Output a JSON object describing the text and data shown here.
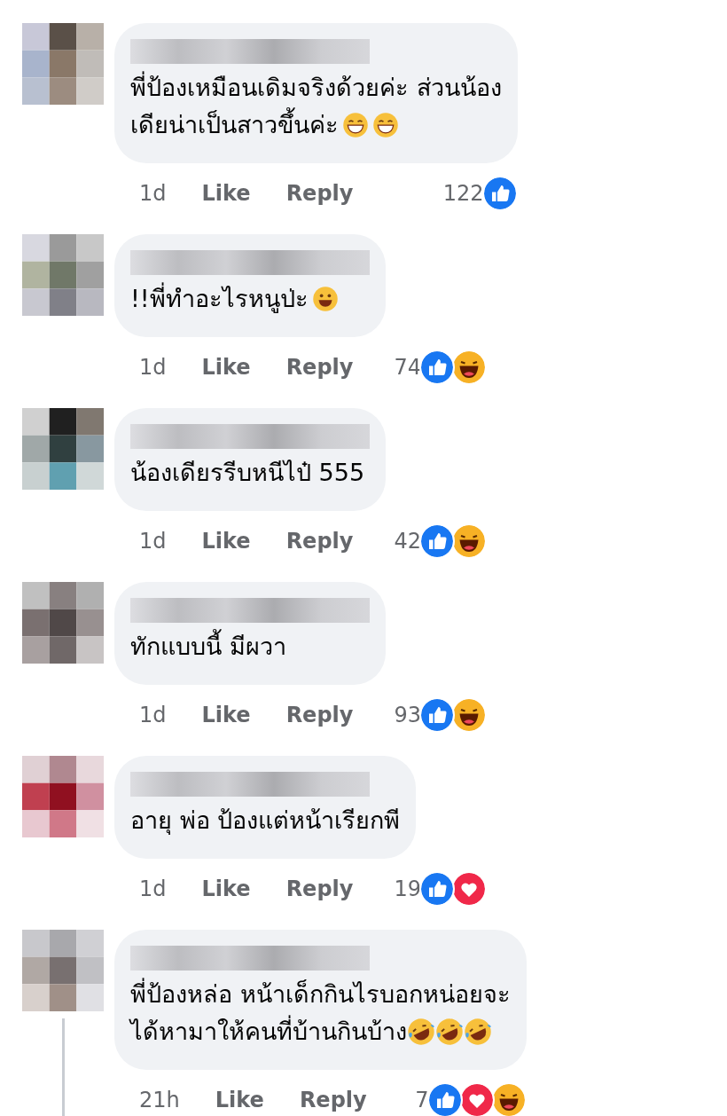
{
  "comments": [
    {
      "text_lines": [
        "พี่ป้องเหมือนเดิมจริงด้วยค่ะ ส่วนน้อง",
        "เดียน่าเป็นสาวขึ้นค่ะ"
      ],
      "emoji": [
        {
          "kind": "grin"
        },
        {
          "kind": "grin"
        }
      ],
      "time": "1d",
      "like": "Like",
      "reply": "Reply",
      "count": "122",
      "reactions": [
        {
          "kind": "like"
        }
      ],
      "thread": false
    },
    {
      "text_lines": [
        "!!พี่ทำอะไรหนูป่ะ"
      ],
      "emoji": [
        {
          "kind": "smile"
        }
      ],
      "time": "1d",
      "like": "Like",
      "reply": "Reply",
      "count": "74",
      "reactions": [
        {
          "kind": "like"
        },
        {
          "kind": "haha"
        }
      ],
      "thread": false
    },
    {
      "text_lines": [
        "น้องเดียรรีบหนีไป๋ 555"
      ],
      "time": "1d",
      "like": "Like",
      "reply": "Reply",
      "count": "42",
      "reactions": [
        {
          "kind": "like"
        },
        {
          "kind": "haha"
        }
      ],
      "thread": false
    },
    {
      "text_lines": [
        "ทักแบบนี้ มีผวา"
      ],
      "time": "1d",
      "like": "Like",
      "reply": "Reply",
      "count": "93",
      "reactions": [
        {
          "kind": "like"
        },
        {
          "kind": "haha"
        }
      ],
      "thread": false
    },
    {
      "text_lines": [
        "อายุ พ่อ ป้องแต่หน้าเรียกพี"
      ],
      "time": "1d",
      "like": "Like",
      "reply": "Reply",
      "count": "19",
      "reactions": [
        {
          "kind": "like"
        },
        {
          "kind": "love"
        }
      ],
      "thread": false
    },
    {
      "text_lines": [
        "พี่ป้องหล่อ หน้าเด็กกินไรบอกหน่อยจะ",
        "ได้หามาให้คนที่บ้านกินบ้าง"
      ],
      "emoji": [
        {
          "kind": "rofl"
        },
        {
          "kind": "rofl"
        },
        {
          "kind": "rofl"
        }
      ],
      "time": "21h",
      "like": "Like",
      "reply": "Reply",
      "count": "7",
      "reactions": [
        {
          "kind": "like"
        },
        {
          "kind": "love"
        },
        {
          "kind": "haha"
        }
      ],
      "thread": true
    }
  ]
}
